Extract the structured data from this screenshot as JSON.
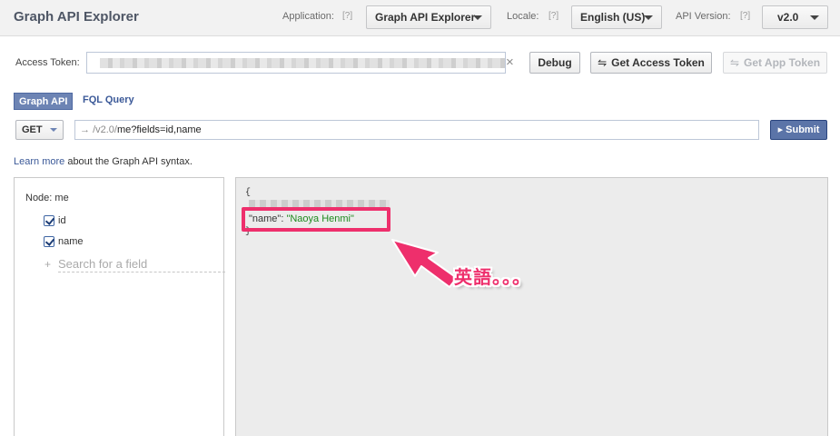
{
  "header": {
    "title": "Graph API Explorer",
    "application_label": "Application:",
    "application_value": "Graph API Explorer",
    "locale_label": "Locale:",
    "locale_value": "English (US)",
    "api_version_label": "API Version:",
    "api_version_value": "v2.0",
    "help_mark": "[?]"
  },
  "token": {
    "label": "Access Token:",
    "clear": "×",
    "debug": "Debug",
    "get_access_token": "Get Access Token",
    "get_app_token": "Get App Token",
    "swap_icon": "⇋"
  },
  "tabs": {
    "graph_api": "Graph API",
    "fql_query": "FQL Query"
  },
  "query": {
    "method": "GET",
    "arrow": "→",
    "version_prefix": "/v2.0/",
    "path": "me?fields=id,name",
    "submit": "Submit",
    "submit_icon": "▸"
  },
  "help_text": {
    "link": "Learn more",
    "rest": " about the Graph API syntax."
  },
  "fields_pane": {
    "node_label": "Node: me",
    "fields": [
      "id",
      "name"
    ],
    "search_placeholder": "Search for a field",
    "search_plus": "+"
  },
  "result": {
    "open_brace": "{",
    "close_brace": "}",
    "name_key": "\"name\": ",
    "name_value": "\"Naoya Henmi\""
  },
  "annotation": {
    "text": "英語。。。",
    "color": "#ee2f6c"
  }
}
